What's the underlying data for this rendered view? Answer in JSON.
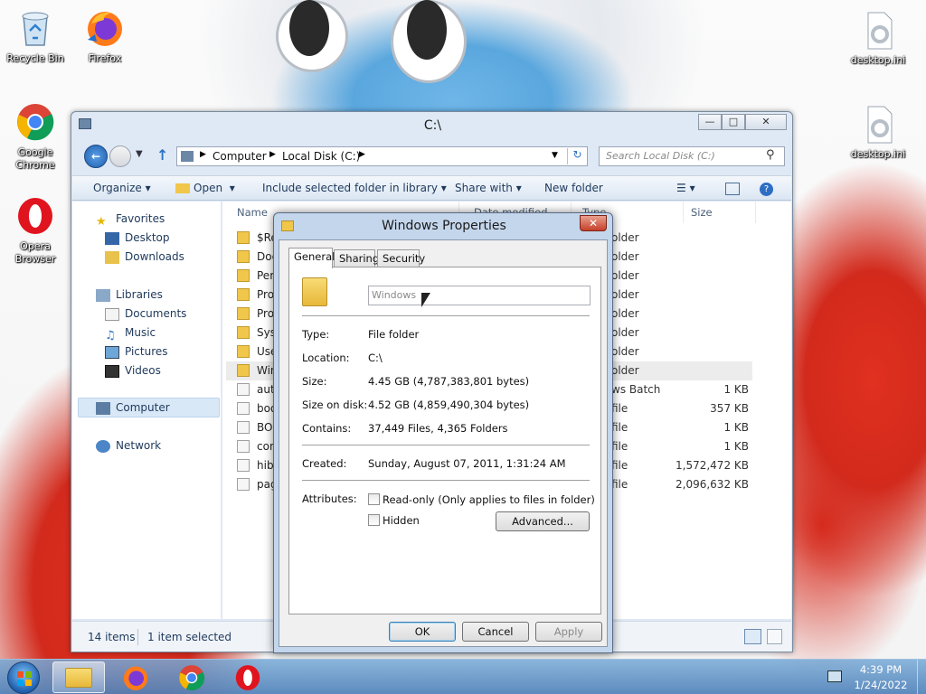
{
  "desktop": {
    "icons": [
      {
        "label": "Recycle Bin"
      },
      {
        "label": "Firefox"
      },
      {
        "label": "Google Chrome"
      },
      {
        "label": "Opera Browser"
      },
      {
        "label": "desktop.ini"
      },
      {
        "label": "desktop.ini"
      }
    ]
  },
  "explorer": {
    "title": "C:\\",
    "address": {
      "segments": [
        "Computer",
        "Local Disk (C:)"
      ]
    },
    "search_placeholder": "Search Local Disk (C:)",
    "commands": {
      "organize": "Organize",
      "open": "Open",
      "include": "Include selected folder in library",
      "share": "Share with",
      "new_folder": "New folder"
    },
    "nav": {
      "favorites": "Favorites",
      "desktop": "Desktop",
      "downloads": "Downloads",
      "libraries": "Libraries",
      "documents": "Documents",
      "music": "Music",
      "pictures": "Pictures",
      "videos": "Videos",
      "computer": "Computer",
      "network": "Network"
    },
    "columns": {
      "name": "Name",
      "date": "Date modified",
      "type": "Type",
      "size": "Size"
    },
    "files": [
      {
        "name": "$Re",
        "type": "older",
        "size": ""
      },
      {
        "name": "Doc",
        "type": "older",
        "size": ""
      },
      {
        "name": "Perf",
        "type": "older",
        "size": ""
      },
      {
        "name": "Prog",
        "type": "older",
        "size": ""
      },
      {
        "name": "Prog",
        "type": "older",
        "size": ""
      },
      {
        "name": "Syst",
        "type": "older",
        "size": ""
      },
      {
        "name": "User",
        "type": "older",
        "size": ""
      },
      {
        "name": "Win",
        "type": "older",
        "size": ""
      },
      {
        "name": "auto",
        "type": "ws Batch File",
        "size": "1 KB"
      },
      {
        "name": "boo",
        "type": "file",
        "size": "357 KB"
      },
      {
        "name": "BOO",
        "type": "file",
        "size": "1 KB"
      },
      {
        "name": "conf",
        "type": "file",
        "size": "1 KB"
      },
      {
        "name": "hibe",
        "type": "file",
        "size": "1,572,472 KB"
      },
      {
        "name": "pag",
        "type": "file",
        "size": "2,096,632 KB"
      }
    ],
    "status": {
      "items": "14 items",
      "selected": "1 item selected"
    }
  },
  "dialog": {
    "title": "Windows Properties",
    "tabs": [
      "General",
      "Sharing",
      "Security"
    ],
    "name_value": "Windows",
    "props": {
      "type_label": "Type:",
      "type_value": "File folder",
      "location_label": "Location:",
      "location_value": "C:\\",
      "size_label": "Size:",
      "size_value": "4.45 GB (4,787,383,801 bytes)",
      "disk_label": "Size on disk:",
      "disk_value": "4.52 GB (4,859,490,304 bytes)",
      "contains_label": "Contains:",
      "contains_value": "37,449 Files, 4,365 Folders",
      "created_label": "Created:",
      "created_value": "Sunday, August 07, 2011, 1:31:24 AM",
      "attributes_label": "Attributes:"
    },
    "readonly_label": "Read-only (Only applies to files in folder)",
    "hidden_label": "Hidden",
    "advanced_label": "Advanced...",
    "ok_label": "OK",
    "cancel_label": "Cancel",
    "apply_label": "Apply"
  },
  "taskbar": {
    "time": "4:39 PM",
    "date": "1/24/2022"
  }
}
